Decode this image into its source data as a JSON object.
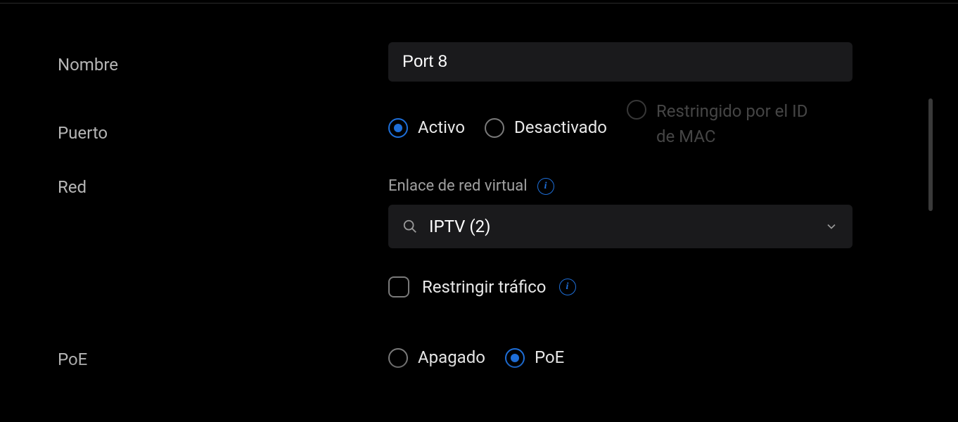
{
  "labels": {
    "name": "Nombre",
    "port": "Puerto",
    "network": "Red",
    "poe": "PoE"
  },
  "name_value": "Port 8",
  "port_options": {
    "active": "Activo",
    "disabled": "Desactivado",
    "restricted": "Restringido por el ID de MAC"
  },
  "network": {
    "sublabel": "Enlace de red virtual",
    "selected": "IPTV (2)",
    "restrict_label": "Restringir tráfico"
  },
  "poe_options": {
    "off": "Apagado",
    "poe": "PoE"
  }
}
